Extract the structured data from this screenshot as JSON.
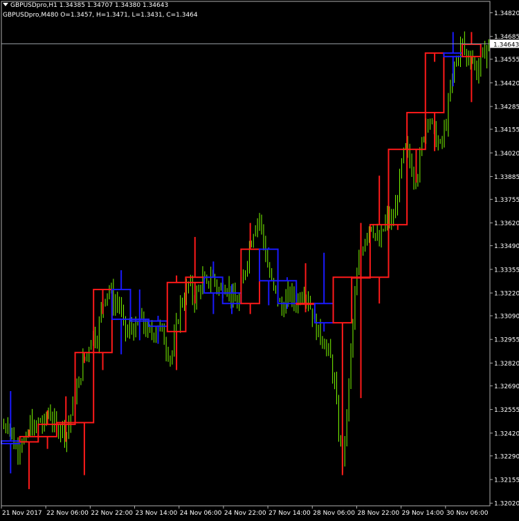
{
  "header": {
    "line1": "GBPUSDpro,H1  1.34385 1.34707 1.34380 1.34643",
    "line2": "GBPUSDpro,M480   O=1.3457,  H=1.3471,  L=1.3431,  C=1.3464"
  },
  "colors": {
    "background": "#000000",
    "grid_frame": "#b0b0b0",
    "h1_candles": "#7CFC00",
    "m480_bull": "#ff1a1a",
    "m480_bear": "#1a1aff",
    "price_line": "#9aa0a6"
  },
  "chart_data": {
    "type": "candlestick",
    "title": "GBPUSDpro",
    "grid": false,
    "current_price": "1.34643",
    "y_ticks": [
      "1.34820",
      "1.34685",
      "1.34555",
      "1.34420",
      "1.34285",
      "1.34155",
      "1.34020",
      "1.33885",
      "1.33755",
      "1.33620",
      "1.33490",
      "1.33355",
      "1.33220",
      "1.33090",
      "1.32955",
      "1.32820",
      "1.32690",
      "1.32555",
      "1.32420",
      "1.32290",
      "1.32155",
      "1.32020"
    ],
    "x_ticks": [
      "21 Nov 2017",
      "22 Nov 06:00",
      "22 Nov 22:00",
      "23 Nov 14:00",
      "24 Nov 06:00",
      "24 Nov 22:00",
      "27 Nov 14:00",
      "28 Nov 06:00",
      "28 Nov 22:00",
      "29 Nov 14:00",
      "30 Nov 06:00"
    ],
    "ylim": [
      1.32005,
      1.34885
    ],
    "h1_close_path": [
      1.3245,
      1.325,
      1.3238,
      1.3232,
      1.324,
      1.3235,
      1.3248,
      1.3243,
      1.325,
      1.3245,
      1.3255,
      1.325,
      1.3243,
      1.3248,
      1.324,
      1.325,
      1.3262,
      1.327,
      1.3283,
      1.3288,
      1.33,
      1.3295,
      1.331,
      1.3322,
      1.3325,
      1.3315,
      1.3318,
      1.3305,
      1.3298,
      1.3303,
      1.33,
      1.3308,
      1.3302,
      1.3298,
      1.33,
      1.3305,
      1.3298,
      1.329,
      1.3285,
      1.33,
      1.3315,
      1.332,
      1.3328,
      1.3318,
      1.3322,
      1.333,
      1.3325,
      1.3333,
      1.3328,
      1.3322,
      1.3328,
      1.3325,
      1.3318,
      1.3315,
      1.3325,
      1.334,
      1.3352,
      1.3362,
      1.3365,
      1.335,
      1.3335,
      1.3325,
      1.332,
      1.3312,
      1.3318,
      1.3322,
      1.3316,
      1.332,
      1.3325,
      1.3318,
      1.331,
      1.33,
      1.3298,
      1.3292,
      1.3285,
      1.327,
      1.324,
      1.3225,
      1.326,
      1.33,
      1.333,
      1.3345,
      1.3355,
      1.3362,
      1.3358,
      1.3348,
      1.3358,
      1.3365,
      1.3362,
      1.3372,
      1.3392,
      1.3405,
      1.3398,
      1.3388,
      1.3392,
      1.341,
      1.3425,
      1.3418,
      1.341,
      1.3405,
      1.3415,
      1.3432,
      1.345,
      1.3458,
      1.3465,
      1.3455,
      1.346,
      1.3448,
      1.3452,
      1.346,
      1.3464
    ],
    "m480_candles": [
      {
        "open": 1.32375,
        "high": 1.3266,
        "low": 1.3219,
        "close": 1.3236
      },
      {
        "open": 1.3237,
        "high": 1.3244,
        "low": 1.321,
        "close": 1.324
      },
      {
        "open": 1.324,
        "high": 1.3255,
        "low": 1.3233,
        "close": 1.3247
      },
      {
        "open": 1.3247,
        "high": 1.3263,
        "low": 1.3237,
        "close": 1.3248
      },
      {
        "open": 1.3248,
        "high": 1.3282,
        "low": 1.3218,
        "close": 1.3288
      },
      {
        "open": 1.3288,
        "high": 1.331,
        "low": 1.3278,
        "close": 1.3324
      },
      {
        "open": 1.3324,
        "high": 1.3335,
        "low": 1.3287,
        "close": 1.3307
      },
      {
        "open": 1.3307,
        "high": 1.3324,
        "low": 1.3295,
        "close": 1.3306
      },
      {
        "open": 1.3306,
        "high": 1.3309,
        "low": 1.3293,
        "close": 1.3303
      },
      {
        "open": 1.33,
        "high": 1.3332,
        "low": 1.3278,
        "close": 1.3328
      },
      {
        "open": 1.3328,
        "high": 1.3354,
        "low": 1.3316,
        "close": 1.3331
      },
      {
        "open": 1.3331,
        "high": 1.334,
        "low": 1.331,
        "close": 1.3322
      },
      {
        "open": 1.3322,
        "high": 1.3327,
        "low": 1.331,
        "close": 1.3316
      },
      {
        "open": 1.3316,
        "high": 1.3362,
        "low": 1.331,
        "close": 1.3347
      },
      {
        "open": 1.3347,
        "high": 1.3348,
        "low": 1.3315,
        "close": 1.3329
      },
      {
        "open": 1.3329,
        "high": 1.3331,
        "low": 1.3313,
        "close": 1.3316
      },
      {
        "open": 1.3316,
        "high": 1.3339,
        "low": 1.3311,
        "close": 1.3316
      },
      {
        "open": 1.3316,
        "high": 1.3345,
        "low": 1.33,
        "close": 1.3305
      },
      {
        "open": 1.3305,
        "high": 1.3331,
        "low": 1.3218,
        "close": 1.3331
      },
      {
        "open": 1.3331,
        "high": 1.3362,
        "low": 1.3262,
        "close": 1.3331
      },
      {
        "open": 1.3331,
        "high": 1.3389,
        "low": 1.3316,
        "close": 1.3361
      },
      {
        "open": 1.3361,
        "high": 1.3404,
        "low": 1.3358,
        "close": 1.3404
      },
      {
        "open": 1.3404,
        "high": 1.3425,
        "low": 1.3385,
        "close": 1.3425
      },
      {
        "open": 1.3425,
        "high": 1.3454,
        "low": 1.3403,
        "close": 1.3459
      },
      {
        "open": 1.3459,
        "high": 1.3471,
        "low": 1.344,
        "close": 1.3457
      },
      {
        "open": 1.3457,
        "high": 1.3471,
        "low": 1.3431,
        "close": 1.3464
      }
    ]
  }
}
